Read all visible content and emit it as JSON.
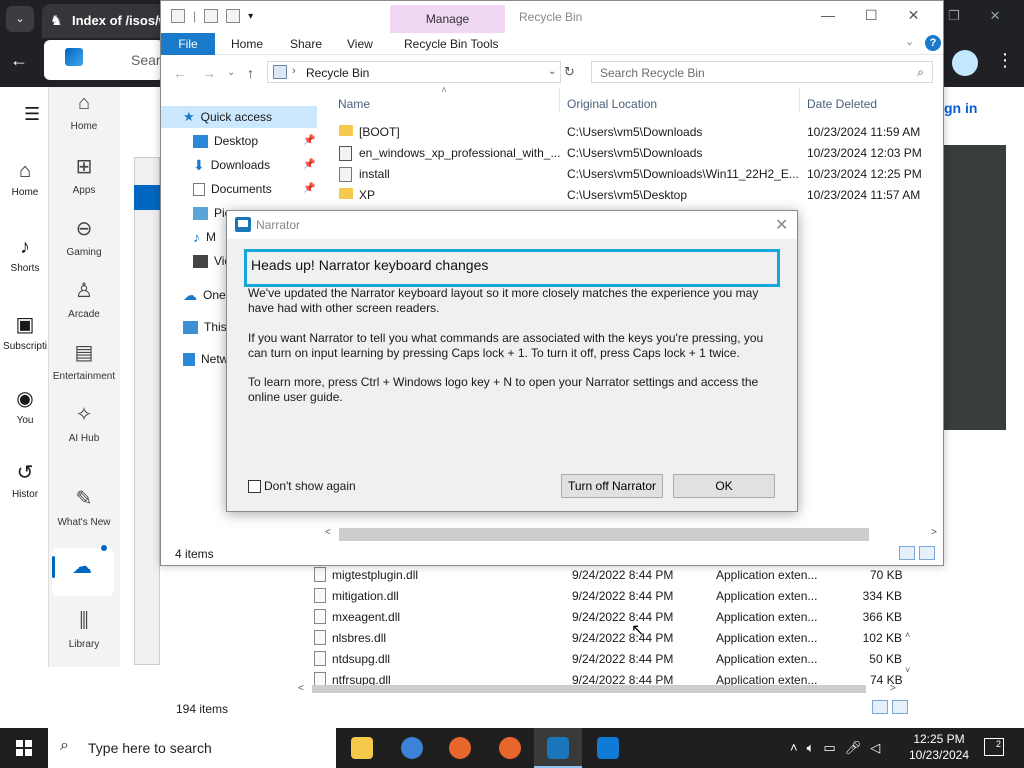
{
  "browser": {
    "tab_title": "Index of /isos/w",
    "omnibox_text": "Sear",
    "sign_in_partial": "gn in"
  },
  "youtube_sidebar": [
    {
      "label": "Home",
      "icon": "home-icon"
    },
    {
      "label": "Shorts",
      "icon": "shorts-icon"
    },
    {
      "label": "Subscripti",
      "icon": "subscriptions-icon"
    },
    {
      "label": "You",
      "icon": "you-icon"
    },
    {
      "label": "Histor",
      "icon": "history-icon"
    }
  ],
  "store_nav": [
    {
      "label": "Home",
      "icon": "home-icon"
    },
    {
      "label": "Apps",
      "icon": "apps-icon"
    },
    {
      "label": "Gaming",
      "icon": "gaming-icon"
    },
    {
      "label": "Arcade",
      "icon": "arcade-icon"
    },
    {
      "label": "Entertainment",
      "icon": "entertainment-icon"
    },
    {
      "label": "AI Hub",
      "icon": "ai-hub-icon"
    },
    {
      "label": "What's New",
      "icon": "whats-new-icon"
    },
    {
      "label": "Library",
      "icon": "library-icon"
    }
  ],
  "lower_explorer": {
    "files": [
      {
        "name": "migtestplugin.dll",
        "date": "9/24/2022 8:44 PM",
        "type": "Application exten...",
        "size": "70 KB"
      },
      {
        "name": "mitigation.dll",
        "date": "9/24/2022 8:44 PM",
        "type": "Application exten...",
        "size": "334 KB"
      },
      {
        "name": "mxeagent.dll",
        "date": "9/24/2022 8:44 PM",
        "type": "Application exten...",
        "size": "366 KB"
      },
      {
        "name": "nlsbres.dll",
        "date": "9/24/2022 8:44 PM",
        "type": "Application exten...",
        "size": "102 KB"
      },
      {
        "name": "ntdsupg.dll",
        "date": "9/24/2022 8:44 PM",
        "type": "Application exten...",
        "size": "50 KB"
      },
      {
        "name": "ntfrsupg.dll",
        "date": "9/24/2022 8:44 PM",
        "type": "Application exten...",
        "size": "74 KB"
      }
    ],
    "status": "194 items"
  },
  "recycle_bin": {
    "manage_tab": "Manage",
    "title": "Recycle Bin",
    "ribbon_tabs": [
      "File",
      "Home",
      "Share",
      "View",
      "Recycle Bin Tools"
    ],
    "address": "Recycle Bin",
    "search_placeholder": "Search Recycle Bin",
    "nav": {
      "quick_access": "Quick access",
      "items": [
        "Desktop",
        "Downloads",
        "Documents",
        "Pic",
        "M",
        "Vid"
      ],
      "onedrive": "One",
      "this_pc": "This",
      "network": "Netw"
    },
    "columns": [
      "Name",
      "Original Location",
      "Date Deleted"
    ],
    "rows": [
      {
        "name": "[BOOT]",
        "location": "C:\\Users\\vm5\\Downloads",
        "date": "10/23/2024 11:59 AM",
        "icon": "folder"
      },
      {
        "name": "en_windows_xp_professional_with_...",
        "location": "C:\\Users\\vm5\\Downloads",
        "date": "10/23/2024 12:03 PM",
        "icon": "iso"
      },
      {
        "name": "install",
        "location": "C:\\Users\\vm5\\Downloads\\Win11_22H2_E...",
        "date": "10/23/2024 12:25 PM",
        "icon": "file"
      },
      {
        "name": "XP",
        "location": "C:\\Users\\vm5\\Desktop",
        "date": "10/23/2024 11:57 AM",
        "icon": "folder"
      }
    ],
    "status": "4 items"
  },
  "narrator": {
    "title": "Narrator",
    "heading": "Heads up! Narrator keyboard changes",
    "para1": "We've updated the Narrator keyboard layout so it more closely matches the experience you may have had with other screen readers.",
    "para2": "If you want Narrator to tell you what commands are associated with the keys you're pressing, you can turn on input learning by pressing Caps lock + 1. To turn it off, press Caps lock + 1 twice.",
    "para3": "To learn more, press Ctrl + Windows logo key + N to open your Narrator settings and access the online user guide.",
    "checkbox_label": "Don't show again",
    "turn_off_button": "Turn off Narrator",
    "ok_button": "OK"
  },
  "taskbar": {
    "search_placeholder": "Type here to search",
    "time": "12:25 PM",
    "date": "10/23/2024",
    "notification_count": "2"
  },
  "colors": {
    "accent": "#1979ca",
    "focus_highlight": "#13a4d8",
    "manage_tab": "#f0d8f3",
    "taskbar": "#1f1f1f"
  }
}
